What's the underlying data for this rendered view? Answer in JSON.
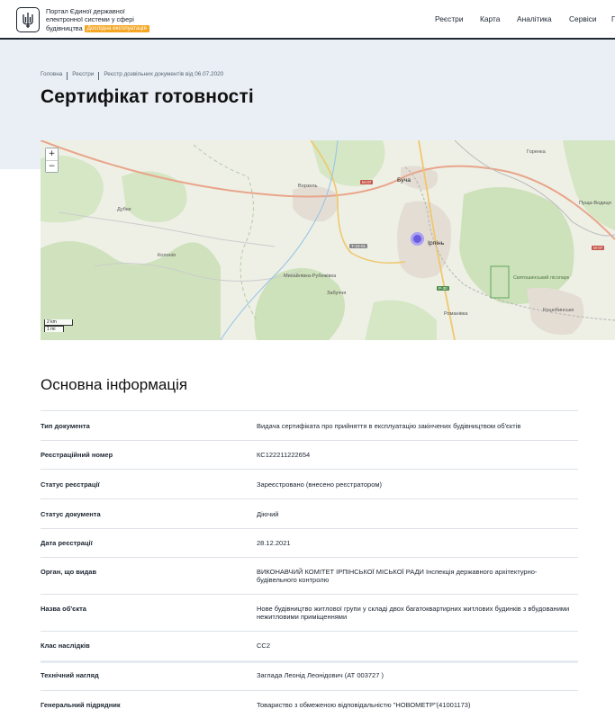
{
  "header": {
    "brand_line1": "Портал Єдиної державної",
    "brand_line2": "електронної системи у сфері",
    "brand_line3": "будівництва",
    "badge": "Дослідна експлуатація",
    "nav": [
      "Реєстри",
      "Карта",
      "Аналітика",
      "Сервіси",
      "П"
    ]
  },
  "breadcrumb": {
    "items": [
      "Головна",
      "Реєстри",
      "Реєстр дозвільних документів від 06.07.2020"
    ]
  },
  "page": {
    "title": "Сертифікат готовності"
  },
  "map": {
    "zoom_in": "+",
    "zoom_out": "−",
    "scale_km": "2 km",
    "scale_mi": "1 mi",
    "labels": {
      "vorzel": "Ворзель",
      "bucha": "Буча",
      "irpin": "Ірпінь",
      "horenka": "Горенка",
      "pushcha": "Пуща-Водиця",
      "dubky": "Дубки",
      "kolonshchyna": "Колонія",
      "mykhailivka": "Михайлівка-Рубежівка",
      "zabuchia": "Забуччя",
      "romanivka": "Романівка",
      "kotsiubynske": "Коцюбинське",
      "sviatoshynskyi": "Святошинський лісопарк"
    },
    "roads": [
      "М-07",
      "М-07",
      "Т-10-01",
      "Р-30"
    ]
  },
  "section": {
    "title": "Основна інформація"
  },
  "info": {
    "rows": [
      {
        "key": "Тип документа",
        "value": "Видача сертифіката про прийняття в експлуатацію закінчених будівництвом об'єктів"
      },
      {
        "key": "Реєстраційний номер",
        "value": "КС122211222654"
      },
      {
        "key": "Статус реєстрації",
        "value": "Зареєстровано (внесено реєстратором)"
      },
      {
        "key": "Статус документа",
        "value": "Діючий"
      },
      {
        "key": "Дата реєстрації",
        "value": "28.12.2021"
      },
      {
        "key": "Орган, що видав",
        "value": "ВИКОНАВЧИЙ КОМІТЕТ ІРПІНСЬКОЇ МІСЬКОЇ РАДИ Інспекція державного архітектурно-будівельного контролю"
      },
      {
        "key": "Назва об'єкта",
        "value": "Нове будівництво житлової групи у складі двох багатоквартирних житлових будинків з вбудованими нежитловими приміщеннями"
      },
      {
        "key": "Клас наслідків",
        "value": "СС2"
      },
      {
        "key": "Технічний нагляд",
        "value": "Заглада Леонід Леонідович (АТ 003727 )"
      },
      {
        "key": "Генеральний підрядник",
        "value": "Товариство з обмеженою відповідальністю \"НОВОМЕТР\"(41001173)"
      }
    ]
  }
}
